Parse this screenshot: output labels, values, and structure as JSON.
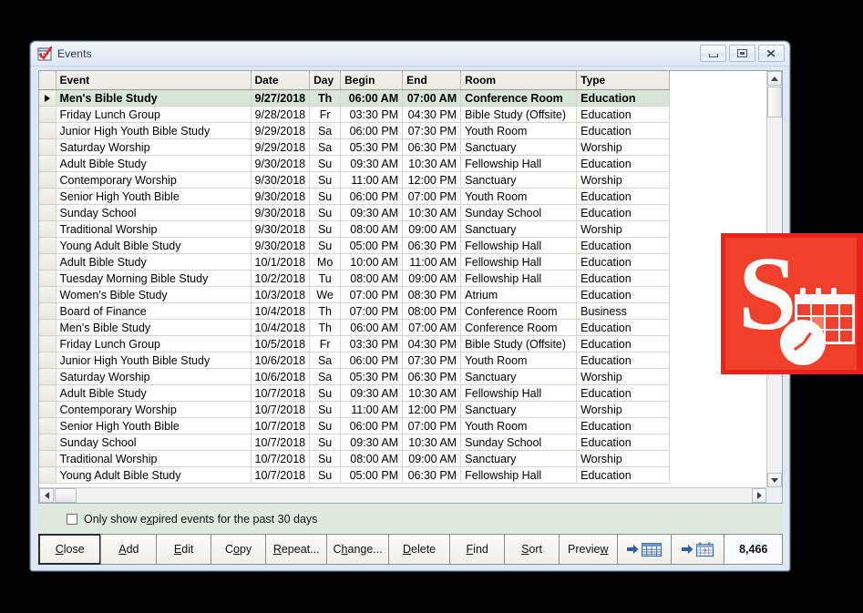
{
  "window": {
    "title": "Events",
    "icon": "events-calendar-icon",
    "controls": {
      "minimize": "minimize",
      "maximize": "maximize",
      "close": "close"
    }
  },
  "grid": {
    "columns": [
      {
        "key": "selector",
        "label": ""
      },
      {
        "key": "event",
        "label": "Event"
      },
      {
        "key": "date",
        "label": "Date"
      },
      {
        "key": "day",
        "label": "Day"
      },
      {
        "key": "begin",
        "label": "Begin"
      },
      {
        "key": "end",
        "label": "End"
      },
      {
        "key": "room",
        "label": "Room"
      },
      {
        "key": "type",
        "label": "Type"
      }
    ],
    "selected_row_index": 0,
    "selected_row_marker": "▶",
    "rows": [
      {
        "event": "Men's Bible Study",
        "date": "9/27/2018",
        "day": "Th",
        "begin": "06:00 AM",
        "end": "07:00 AM",
        "room": "Conference Room",
        "type": "Education"
      },
      {
        "event": "Friday Lunch Group",
        "date": "9/28/2018",
        "day": "Fr",
        "begin": "03:30 PM",
        "end": "04:30 PM",
        "room": "Bible Study (Offsite)",
        "type": "Education"
      },
      {
        "event": "Junior High Youth Bible Study",
        "date": "9/29/2018",
        "day": "Sa",
        "begin": "06:00 PM",
        "end": "07:30 PM",
        "room": "Youth Room",
        "type": "Education"
      },
      {
        "event": "Saturday Worship",
        "date": "9/29/2018",
        "day": "Sa",
        "begin": "05:30 PM",
        "end": "06:30 PM",
        "room": "Sanctuary",
        "type": "Worship"
      },
      {
        "event": "Adult Bible Study",
        "date": "9/30/2018",
        "day": "Su",
        "begin": "09:30 AM",
        "end": "10:30 AM",
        "room": "Fellowship Hall",
        "type": "Education"
      },
      {
        "event": "Contemporary Worship",
        "date": "9/30/2018",
        "day": "Su",
        "begin": "11:00 AM",
        "end": "12:00 PM",
        "room": "Sanctuary",
        "type": "Worship"
      },
      {
        "event": "Senior High Youth Bible",
        "date": "9/30/2018",
        "day": "Su",
        "begin": "06:00 PM",
        "end": "07:00 PM",
        "room": "Youth Room",
        "type": "Education"
      },
      {
        "event": "Sunday School",
        "date": "9/30/2018",
        "day": "Su",
        "begin": "09:30 AM",
        "end": "10:30 AM",
        "room": "Sunday School",
        "type": "Education"
      },
      {
        "event": "Traditional Worship",
        "date": "9/30/2018",
        "day": "Su",
        "begin": "08:00 AM",
        "end": "09:00 AM",
        "room": "Sanctuary",
        "type": "Worship"
      },
      {
        "event": "Young Adult Bible Study",
        "date": "9/30/2018",
        "day": "Su",
        "begin": "05:00 PM",
        "end": "06:30 PM",
        "room": "Fellowship Hall",
        "type": "Education"
      },
      {
        "event": "Adult Bible Study",
        "date": "10/1/2018",
        "day": "Mo",
        "begin": "10:00 AM",
        "end": "11:00 AM",
        "room": "Fellowship Hall",
        "type": "Education"
      },
      {
        "event": "Tuesday Morning Bible Study",
        "date": "10/2/2018",
        "day": "Tu",
        "begin": "08:00 AM",
        "end": "09:00 AM",
        "room": "Fellowship Hall",
        "type": "Education"
      },
      {
        "event": "Women's Bible Study",
        "date": "10/3/2018",
        "day": "We",
        "begin": "07:00 PM",
        "end": "08:30 PM",
        "room": "Atrium",
        "type": "Education"
      },
      {
        "event": "Board of Finance",
        "date": "10/4/2018",
        "day": "Th",
        "begin": "07:00 PM",
        "end": "08:00 PM",
        "room": "Conference Room",
        "type": "Business"
      },
      {
        "event": "Men's Bible Study",
        "date": "10/4/2018",
        "day": "Th",
        "begin": "06:00 AM",
        "end": "07:00 AM",
        "room": "Conference Room",
        "type": "Education"
      },
      {
        "event": "Friday Lunch Group",
        "date": "10/5/2018",
        "day": "Fr",
        "begin": "03:30 PM",
        "end": "04:30 PM",
        "room": "Bible Study (Offsite)",
        "type": "Education"
      },
      {
        "event": "Junior High Youth Bible Study",
        "date": "10/6/2018",
        "day": "Sa",
        "begin": "06:00 PM",
        "end": "07:30 PM",
        "room": "Youth Room",
        "type": "Education"
      },
      {
        "event": "Saturday Worship",
        "date": "10/6/2018",
        "day": "Sa",
        "begin": "05:30 PM",
        "end": "06:30 PM",
        "room": "Sanctuary",
        "type": "Worship"
      },
      {
        "event": "Adult Bible Study",
        "date": "10/7/2018",
        "day": "Su",
        "begin": "09:30 AM",
        "end": "10:30 AM",
        "room": "Fellowship Hall",
        "type": "Education"
      },
      {
        "event": "Contemporary Worship",
        "date": "10/7/2018",
        "day": "Su",
        "begin": "11:00 AM",
        "end": "12:00 PM",
        "room": "Sanctuary",
        "type": "Worship"
      },
      {
        "event": "Senior High Youth Bible",
        "date": "10/7/2018",
        "day": "Su",
        "begin": "06:00 PM",
        "end": "07:00 PM",
        "room": "Youth Room",
        "type": "Education"
      },
      {
        "event": "Sunday School",
        "date": "10/7/2018",
        "day": "Su",
        "begin": "09:30 AM",
        "end": "10:30 AM",
        "room": "Sunday School",
        "type": "Education"
      },
      {
        "event": "Traditional Worship",
        "date": "10/7/2018",
        "day": "Su",
        "begin": "08:00 AM",
        "end": "09:00 AM",
        "room": "Sanctuary",
        "type": "Worship"
      },
      {
        "event": "Young Adult Bible Study",
        "date": "10/7/2018",
        "day": "Su",
        "begin": "05:00 PM",
        "end": "06:30 PM",
        "room": "Fellowship Hall",
        "type": "Education"
      }
    ]
  },
  "options": {
    "expired_checkbox": {
      "checked": false,
      "label_pre": "Only show e",
      "label_accel": "x",
      "label_post": "pired events for the past 30 days",
      "label_full": "Only show expired events for the past 30 days"
    }
  },
  "toolbar": {
    "buttons": [
      {
        "name": "close",
        "pre": "",
        "accel": "C",
        "post": "lose",
        "default": true
      },
      {
        "name": "add",
        "pre": "",
        "accel": "A",
        "post": "dd",
        "default": false
      },
      {
        "name": "edit",
        "pre": "",
        "accel": "E",
        "post": "dit",
        "default": false
      },
      {
        "name": "copy",
        "pre": "C",
        "accel": "o",
        "post": "py",
        "default": false
      },
      {
        "name": "repeat",
        "pre": "",
        "accel": "R",
        "post": "epeat...",
        "default": false
      },
      {
        "name": "change",
        "pre": "C",
        "accel": "h",
        "post": "ange...",
        "default": false
      },
      {
        "name": "delete",
        "pre": "",
        "accel": "D",
        "post": "elete",
        "default": false
      },
      {
        "name": "find",
        "pre": "",
        "accel": "F",
        "post": "ind",
        "default": false
      },
      {
        "name": "sort",
        "pre": "",
        "accel": "S",
        "post": "ort",
        "default": false
      },
      {
        "name": "preview",
        "pre": "Previe",
        "accel": "w",
        "post": "",
        "default": false
      }
    ],
    "export_grid": {
      "icon": "export-to-spreadsheet-icon",
      "label": ""
    },
    "export_calendar": {
      "icon": "export-to-calendar-icon",
      "label": ""
    },
    "record_count": "8,466"
  },
  "overlay_logo": {
    "letter": "S",
    "background_color": "#f0402a",
    "border_color": "#e8231b",
    "icons": [
      "calendar-icon",
      "clock-icon"
    ]
  },
  "colors": {
    "selected_row": "#d8e6d8",
    "panel_green": "#dfeadf",
    "window_chrome": "#dfe8f5",
    "logo_red": "#f0402a"
  }
}
